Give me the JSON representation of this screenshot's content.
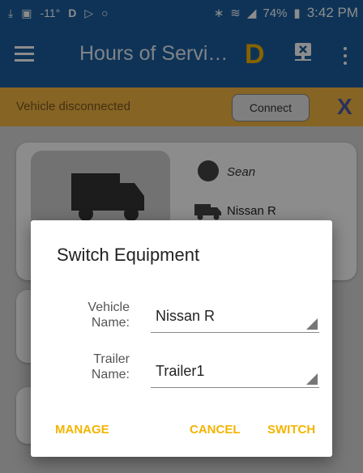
{
  "status_bar": {
    "temp": "-11°",
    "battery": "74%",
    "time": "3:42 PM"
  },
  "app_bar": {
    "title": "Hours of Servi…",
    "logo_letter": "D"
  },
  "banner": {
    "message": "Vehicle disconnected",
    "connect_label": "Connect",
    "close_label": "X"
  },
  "background_card": {
    "driver_name": "Sean",
    "vehicle_name": "Nissan R"
  },
  "dialog": {
    "title": "Switch Equipment",
    "vehicle_label_line1": "Vehicle",
    "vehicle_label_line2": "Name:",
    "vehicle_value": "Nissan R",
    "trailer_label_line1": "Trailer",
    "trailer_label_line2": "Name:",
    "trailer_value": "Trailer1",
    "manage_label": "MANAGE",
    "cancel_label": "CANCEL",
    "switch_label": "SWITCH"
  },
  "colors": {
    "app_bar": "#1a5e9e",
    "banner": "#f5b642",
    "accent": "#f4b400"
  }
}
